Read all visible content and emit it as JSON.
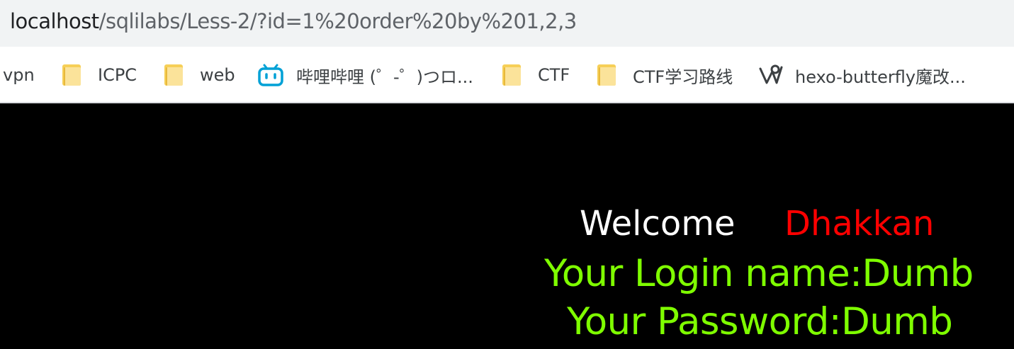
{
  "address_bar": {
    "host": "localhost",
    "path": "/sqlilabs/Less-2/?id=1%20order%20by%201,2,3"
  },
  "bookmarks": [
    {
      "label": "vpn",
      "icon": "none"
    },
    {
      "label": "ICPC",
      "icon": "folder-icon"
    },
    {
      "label": "web",
      "icon": "folder-icon"
    },
    {
      "label": "哔哩哔哩 (゜-゜)つロ...",
      "icon": "bilibili-icon"
    },
    {
      "label": "CTF",
      "icon": "folder-icon"
    },
    {
      "label": "CTF学习路线",
      "icon": "folder-icon"
    },
    {
      "label": "hexo-butterfly魔改...",
      "icon": "hexo-icon"
    }
  ],
  "page": {
    "welcome": "Welcome",
    "welcome_name": "Dhakkan",
    "login_line": "Your Login name:Dumb",
    "password_line": "Your Password:Dumb"
  },
  "colors": {
    "folder": "#f6cf57",
    "bilibili": "#00a1d6",
    "welcome": "#ffffff",
    "name": "#ff0000",
    "result": "#7fff00",
    "background": "#000000"
  }
}
